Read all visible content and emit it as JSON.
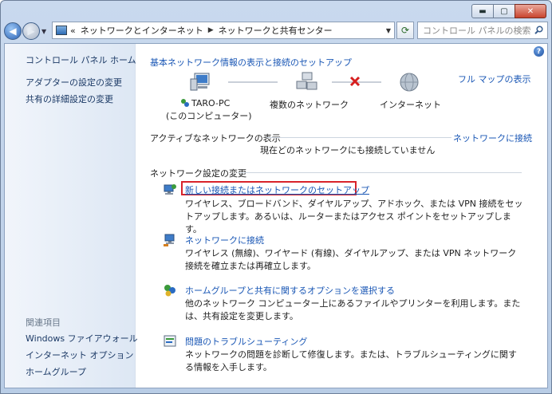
{
  "search": {
    "placeholder": "コントロール パネルの検索"
  },
  "breadcrumb": {
    "prefix": "«",
    "items": [
      "ネットワークとインターネット",
      "ネットワークと共有センター"
    ]
  },
  "sidebar": {
    "items": [
      "コントロール パネル ホーム",
      "アダプターの設定の変更",
      "共有の詳細設定の変更"
    ],
    "related_heading": "関連項目",
    "related": [
      "Windows ファイアウォール",
      "インターネット オプション",
      "ホームグループ"
    ]
  },
  "main": {
    "title": "基本ネットワーク情報の表示と接続のセットアップ",
    "full_map": "フル マップの表示",
    "map": {
      "pc_name": "TARO-PC",
      "pc_sub": "(このコンピューター)",
      "middle": "複数のネットワーク",
      "internet": "インターネット"
    },
    "active_heading": "アクティブなネットワークの表示",
    "connect_link": "ネットワークに接続",
    "no_connection": "現在どのネットワークにも接続していません",
    "change_heading": "ネットワーク設定の変更",
    "tasks": [
      {
        "title": "新しい接続またはネットワークのセットアップ",
        "desc": "ワイヤレス、ブロードバンド、ダイヤルアップ、アドホック、または VPN 接続をセットアップします。あるいは、ルーターまたはアクセス ポイントをセットアップします。"
      },
      {
        "title": "ネットワークに接続",
        "desc": "ワイヤレス (無線)、ワイヤード (有線)、ダイヤルアップ、または VPN ネットワーク接続を確立または再確立します。"
      },
      {
        "title": "ホームグループと共有に関するオプションを選択する",
        "desc": "他のネットワーク コンピューター上にあるファイルやプリンターを利用します。または、共有設定を変更します。"
      },
      {
        "title": "問題のトラブルシューティング",
        "desc": "ネットワークの問題を診断して修復します。または、トラブルシューティングに関する情報を入手します。"
      }
    ]
  },
  "colors": {
    "link": "#1a57b5",
    "highlight": "#d8232a",
    "error_x": "#d61f1f"
  }
}
